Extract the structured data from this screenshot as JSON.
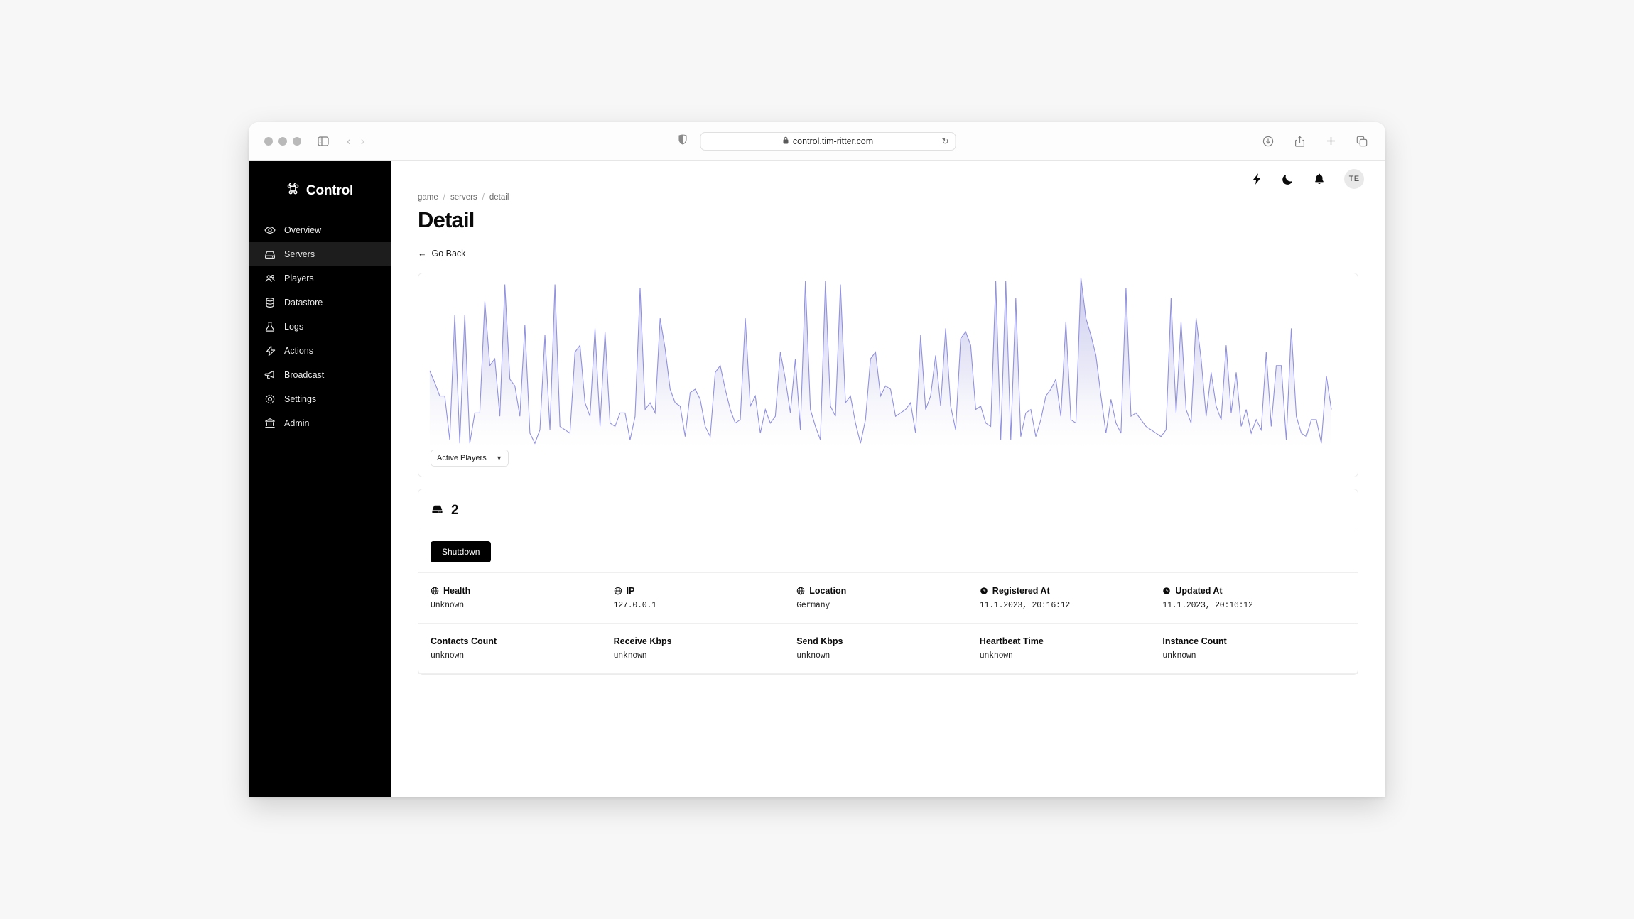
{
  "browser": {
    "url": "control.tim-ritter.com",
    "lock_icon": "lock-icon",
    "reload_icon": "reload-icon",
    "sidebar_toggle_icon": "sidebar-toggle-icon",
    "back_icon": "chevron-left-icon",
    "forward_icon": "chevron-right-icon",
    "shield_icon": "privacy-shield-icon",
    "download_icon": "download-icon",
    "share_icon": "share-icon",
    "new_tab_icon": "plus-icon",
    "tabs_icon": "tab-overview-icon"
  },
  "sidebar": {
    "brand": "Control",
    "brand_icon": "command-icon",
    "items": [
      {
        "label": "Overview",
        "icon": "eye-icon",
        "active": false
      },
      {
        "label": "Servers",
        "icon": "server-icon",
        "active": true
      },
      {
        "label": "Players",
        "icon": "users-icon",
        "active": false
      },
      {
        "label": "Datastore",
        "icon": "database-icon",
        "active": false
      },
      {
        "label": "Logs",
        "icon": "flask-icon",
        "active": false
      },
      {
        "label": "Actions",
        "icon": "lightning-icon",
        "active": false
      },
      {
        "label": "Broadcast",
        "icon": "megaphone-icon",
        "active": false
      },
      {
        "label": "Settings",
        "icon": "gear-icon",
        "active": false
      },
      {
        "label": "Admin",
        "icon": "bank-icon",
        "active": false
      }
    ]
  },
  "topbar": {
    "lightning_icon": "lightning-icon",
    "moon_icon": "moon-icon",
    "bell_icon": "bell-icon",
    "avatar_initials": "TE"
  },
  "header": {
    "breadcrumb": [
      "game",
      "servers",
      "detail"
    ],
    "separator": "/",
    "title": "Detail",
    "go_back": "Go Back",
    "go_back_icon": "arrow-left-icon"
  },
  "chart_card": {
    "metric_select": {
      "value": "Active Players",
      "chevron_icon": "chevron-down-icon"
    }
  },
  "chart_data": {
    "type": "area",
    "title": "Active Players",
    "xlabel": "",
    "ylabel": "Active Players",
    "grid": false,
    "legend": "none",
    "line_color": "#9191de",
    "fill_top_color": "#c9c9ee",
    "fill_bottom_color": "#ffffff",
    "ylim": [
      0,
      100
    ],
    "x": [
      0,
      1,
      2,
      3,
      4,
      5,
      6,
      7,
      8,
      9,
      10,
      11,
      12,
      13,
      14,
      15,
      16,
      17,
      18,
      19,
      20,
      21,
      22,
      23,
      24,
      25,
      26,
      27,
      28,
      29,
      30,
      31,
      32,
      33,
      34,
      35,
      36,
      37,
      38,
      39,
      40,
      41,
      42,
      43,
      44,
      45,
      46,
      47,
      48,
      49,
      50,
      51,
      52,
      53,
      54,
      55,
      56,
      57,
      58,
      59,
      60,
      61,
      62,
      63,
      64,
      65,
      66,
      67,
      68,
      69,
      70,
      71,
      72,
      73,
      74,
      75,
      76,
      77,
      78,
      79,
      80,
      81,
      82,
      83,
      84,
      85,
      86,
      87,
      88,
      89,
      90,
      91,
      92,
      93,
      94,
      95,
      96,
      97,
      98,
      99,
      100,
      101,
      102,
      103,
      104,
      105,
      106,
      107,
      108,
      109,
      110,
      111,
      112,
      113,
      114,
      115,
      116,
      117,
      118,
      119,
      120,
      121,
      122,
      123,
      124,
      125,
      126,
      127,
      128,
      129,
      130,
      131,
      132,
      133,
      134,
      135,
      136,
      137,
      138,
      139,
      140,
      141,
      142,
      143,
      144,
      145,
      146,
      147,
      148,
      149,
      150,
      151,
      152,
      153,
      154,
      155,
      156,
      157,
      158,
      159,
      160,
      161,
      162,
      163,
      164,
      165,
      166,
      167,
      168,
      169,
      170,
      171,
      172,
      173,
      174,
      175,
      176,
      177,
      178,
      179
    ],
    "values": [
      45,
      38,
      30,
      30,
      4,
      78,
      2,
      78,
      2,
      20,
      20,
      86,
      48,
      52,
      18,
      96,
      40,
      36,
      18,
      72,
      8,
      2,
      10,
      66,
      10,
      96,
      12,
      10,
      8,
      56,
      60,
      26,
      18,
      70,
      12,
      68,
      14,
      12,
      20,
      20,
      4,
      18,
      94,
      22,
      26,
      20,
      76,
      58,
      34,
      26,
      24,
      6,
      32,
      34,
      28,
      12,
      6,
      44,
      48,
      34,
      22,
      14,
      16,
      76,
      24,
      30,
      8,
      22,
      14,
      18,
      56,
      40,
      20,
      52,
      10,
      98,
      22,
      12,
      4,
      98,
      24,
      18,
      96,
      26,
      30,
      14,
      2,
      16,
      52,
      56,
      30,
      36,
      34,
      18,
      20,
      22,
      26,
      8,
      66,
      22,
      30,
      54,
      24,
      70,
      24,
      10,
      64,
      68,
      60,
      22,
      24,
      14,
      12,
      98,
      4,
      98,
      4,
      88,
      6,
      20,
      22,
      6,
      16,
      30,
      34,
      40,
      18,
      74,
      16,
      14,
      100,
      76,
      66,
      54,
      30,
      8,
      28,
      14,
      8,
      94,
      18,
      20,
      16,
      12,
      10,
      8,
      6,
      10,
      88,
      20,
      74,
      22,
      14,
      76,
      52,
      18,
      44,
      24,
      16,
      60,
      20,
      44,
      12,
      22,
      8,
      16,
      10,
      56,
      12,
      48,
      48,
      4,
      70,
      18,
      8,
      6,
      16,
      16,
      2,
      42,
      22
    ]
  },
  "server": {
    "icon": "server-icon",
    "id": "2",
    "shutdown_label": "Shutdown",
    "fields_row1": [
      {
        "label": "Health",
        "icon": "globe-icon",
        "value": "Unknown"
      },
      {
        "label": "IP",
        "icon": "globe-icon",
        "value": "127.0.0.1"
      },
      {
        "label": "Location",
        "icon": "globe-icon",
        "value": "Germany"
      },
      {
        "label": "Registered At",
        "icon": "clock-icon",
        "value": "11.1.2023, 20:16:12"
      },
      {
        "label": "Updated At",
        "icon": "clock-icon",
        "value": "11.1.2023, 20:16:12"
      }
    ],
    "fields_row2": [
      {
        "label": "Contacts Count",
        "icon": "",
        "value": "unknown"
      },
      {
        "label": "Receive Kbps",
        "icon": "",
        "value": "unknown"
      },
      {
        "label": "Send Kbps",
        "icon": "",
        "value": "unknown"
      },
      {
        "label": "Heartbeat Time",
        "icon": "",
        "value": "unknown"
      },
      {
        "label": "Instance Count",
        "icon": "",
        "value": "unknown"
      }
    ]
  }
}
